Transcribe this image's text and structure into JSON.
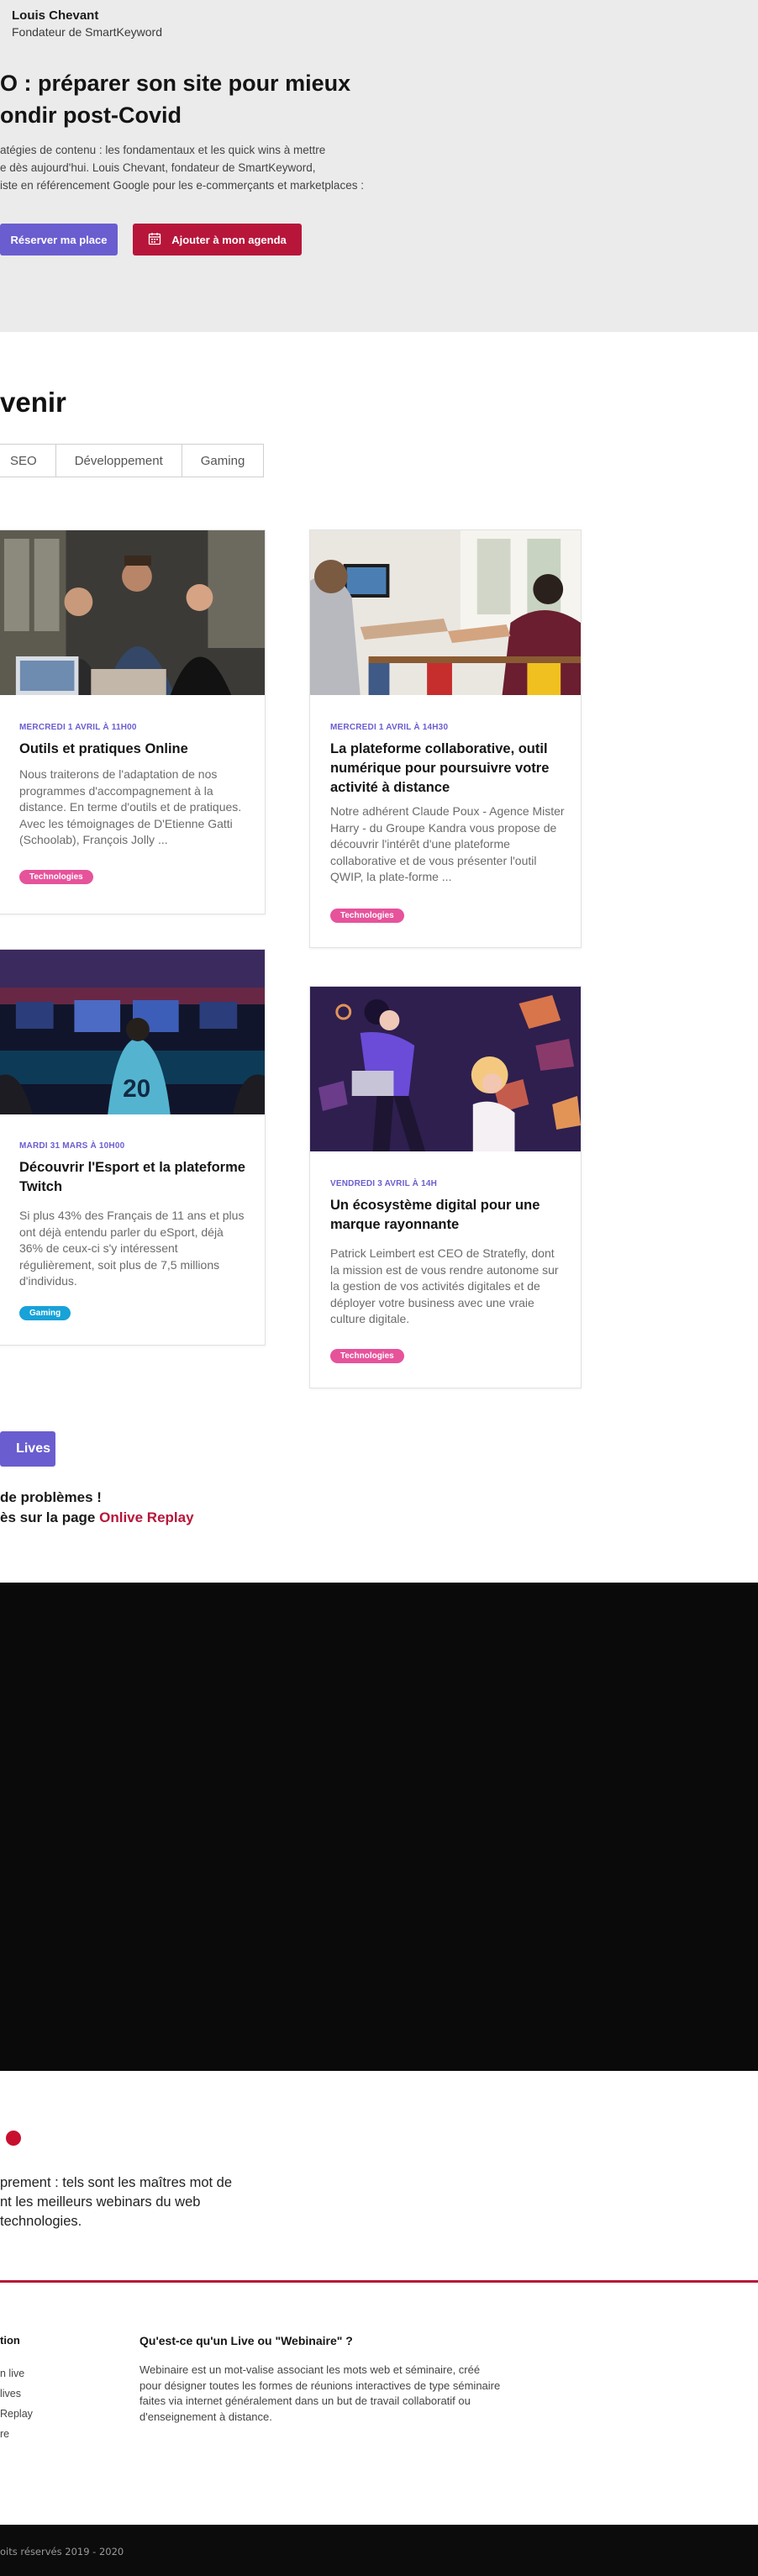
{
  "hero": {
    "speaker_name": "Louis Chevant",
    "speaker_role": "Fondateur de SmartKeyword",
    "title": "O : préparer son site pour mieux\nondir post-Covid",
    "description": "atégies de contenu : les fondamentaux et les quick wins à mettre\ne dès aujourd'hui. Louis Chevant, fondateur de SmartKeyword,\niste en référencement Google pour les e-commerçants et marketplaces :",
    "reserve_label": "Réserver ma place",
    "agenda_label": "Ajouter à mon agenda"
  },
  "upcoming": {
    "title": "venir",
    "tabs": [
      "SEO",
      "Développement",
      "Gaming"
    ]
  },
  "cards": [
    {
      "date": "MERCREDI 1 AVRIL À 11H00",
      "title": "Outils et pratiques Online",
      "description": "Nous traiterons de l'adaptation de nos programmes d'accompagnement à la distance. En terme d'outils et de pratiques. Avec les témoignages de D'Etienne Gatti (Schoolab), François Jolly ...",
      "tag": "Technologies"
    },
    {
      "date": "MERCREDI 1 AVRIL À 14H30",
      "title": "La plateforme collaborative, outil numérique pour poursuivre votre activité à distance",
      "description": "Notre adhérent Claude Poux - Agence Mister Harry - du Groupe Kandra vous propose de découvrir l'intérêt d'une plateforme collaborative et de vous présenter l'outil QWIP, la plate-forme ...",
      "tag": "Technologies"
    },
    {
      "date": "MARDI 31 MARS À 10H00",
      "title": "Découvrir l'Esport\net la plateforme Twitch",
      "description": "Si plus 43% des Français de 11 ans et plus ont déjà entendu parler du eSport, déjà 36% de ceux-ci s'y intéressent régulièrement,\nsoit plus de 7,5 millions d'individus.",
      "tag": "Gaming"
    },
    {
      "date": "VENDREDI 3 AVRIL À 14H",
      "title": "Un écosystème digital\npour une marque rayonnante",
      "description": "Patrick Leimbert est CEO de Stratefly, dont la mission est de vous rendre autonome sur la gestion de vos activités digitales et de déployer votre business avec une vraie culture digitale.",
      "tag": "Technologies"
    }
  ],
  "lives_button": "Lives",
  "problems": {
    "line1": "de problèmes !",
    "line2_prefix": "ès sur la page ",
    "replay_link": "Onlive Replay"
  },
  "tagline": "prement : tels sont les maîtres mot de\nnt les meilleurs webinars du web\ntechnologies.",
  "footer": {
    "col1_title": "tion",
    "links": [
      "n live",
      "lives",
      "Replay",
      "re"
    ],
    "col2_title": "Qu'est-ce qu'un Live ou \"Webinaire\" ?",
    "col2_text": "Webinaire est un mot-valise associant les mots web et séminaire, créé pour désigner toutes les formes de réunions interactives de type séminaire faites via internet généralement dans un but de travail collaboratif ou d'enseignement à distance.",
    "copyright": "oits réservés 2019 - 2020"
  },
  "colors": {
    "accent_purple": "#6a5dd0",
    "accent_red": "#b7163a",
    "tag_technologies": "#e6539b",
    "tag_gaming": "#17a2d8"
  }
}
